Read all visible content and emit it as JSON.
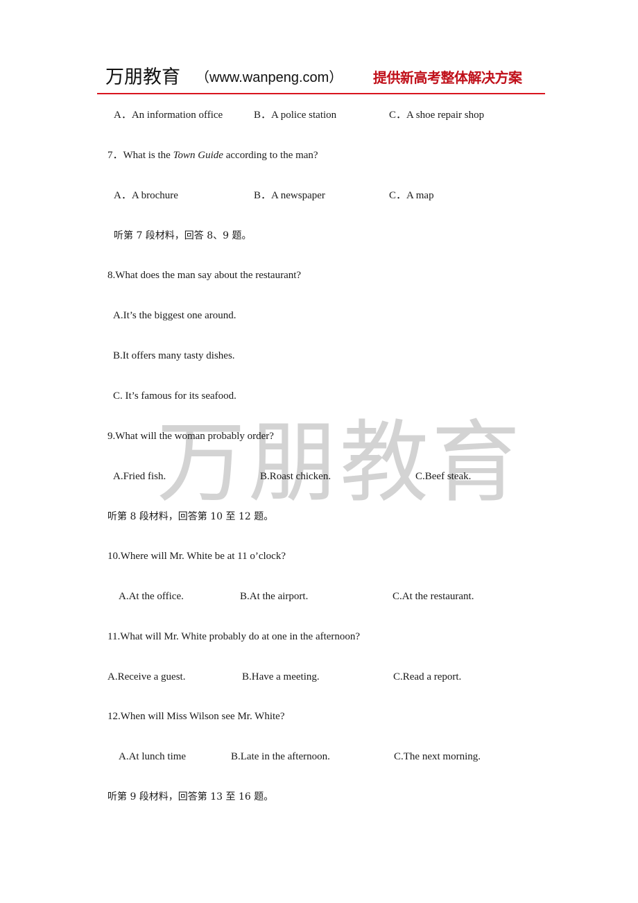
{
  "header": {
    "brand": "万朋教育",
    "site": "（www.wanpeng.com）",
    "slogan": "提供新高考整体解决方案",
    "accent_color": "#d8141e",
    "slogan_color": "#c0101a"
  },
  "watermark": {
    "text": "万朋教育",
    "color": "#d3d3d3"
  },
  "content": {
    "q6_options": {
      "a": "A．An information office",
      "b": "B．A police station",
      "c": "C．A shoe repair shop"
    },
    "q7": {
      "prefix": "7．What is the ",
      "italic": "Town Guide",
      "suffix": " according to the man?",
      "options": {
        "a": "A．A brochure",
        "b": "B．A newspaper",
        "c": "C．A map"
      }
    },
    "section7": "听第 7 段材料，回答 8、9 题。",
    "q8": {
      "question": "8.What does the man say about the restaurant?",
      "options": {
        "a": "A.It’s the biggest one around.",
        "b": "B.It offers many tasty dishes.",
        "c": "C. It’s famous for its seafood."
      }
    },
    "q9": {
      "question": "9.What will the woman probably order?",
      "options": {
        "a": "A.Fried fish.",
        "b": "B.Roast chicken.",
        "c": "C.Beef steak."
      }
    },
    "section8": "听第 8 段材料，回答第 10 至 12 题。",
    "q10": {
      "question": "10.Where will Mr. White be at 11 o’clock?",
      "options": {
        "a": "A.At the office.",
        "b": "B.At the airport.",
        "c": "C.At the restaurant."
      }
    },
    "q11": {
      "question": "11.What will Mr. White probably do at one in the afternoon?",
      "options": {
        "a": "A.Receive a guest.",
        "b": "B.Have a meeting.",
        "c": "C.Read a report."
      }
    },
    "q12": {
      "question": "12.When will Miss Wilson see Mr. White?",
      "options": {
        "a": "A.At lunch time",
        "b": "B.Late in the afternoon.",
        "c": "C.The next morning."
      }
    },
    "section9": "听第 9 段材料，回答第 13 至 16 题。"
  }
}
